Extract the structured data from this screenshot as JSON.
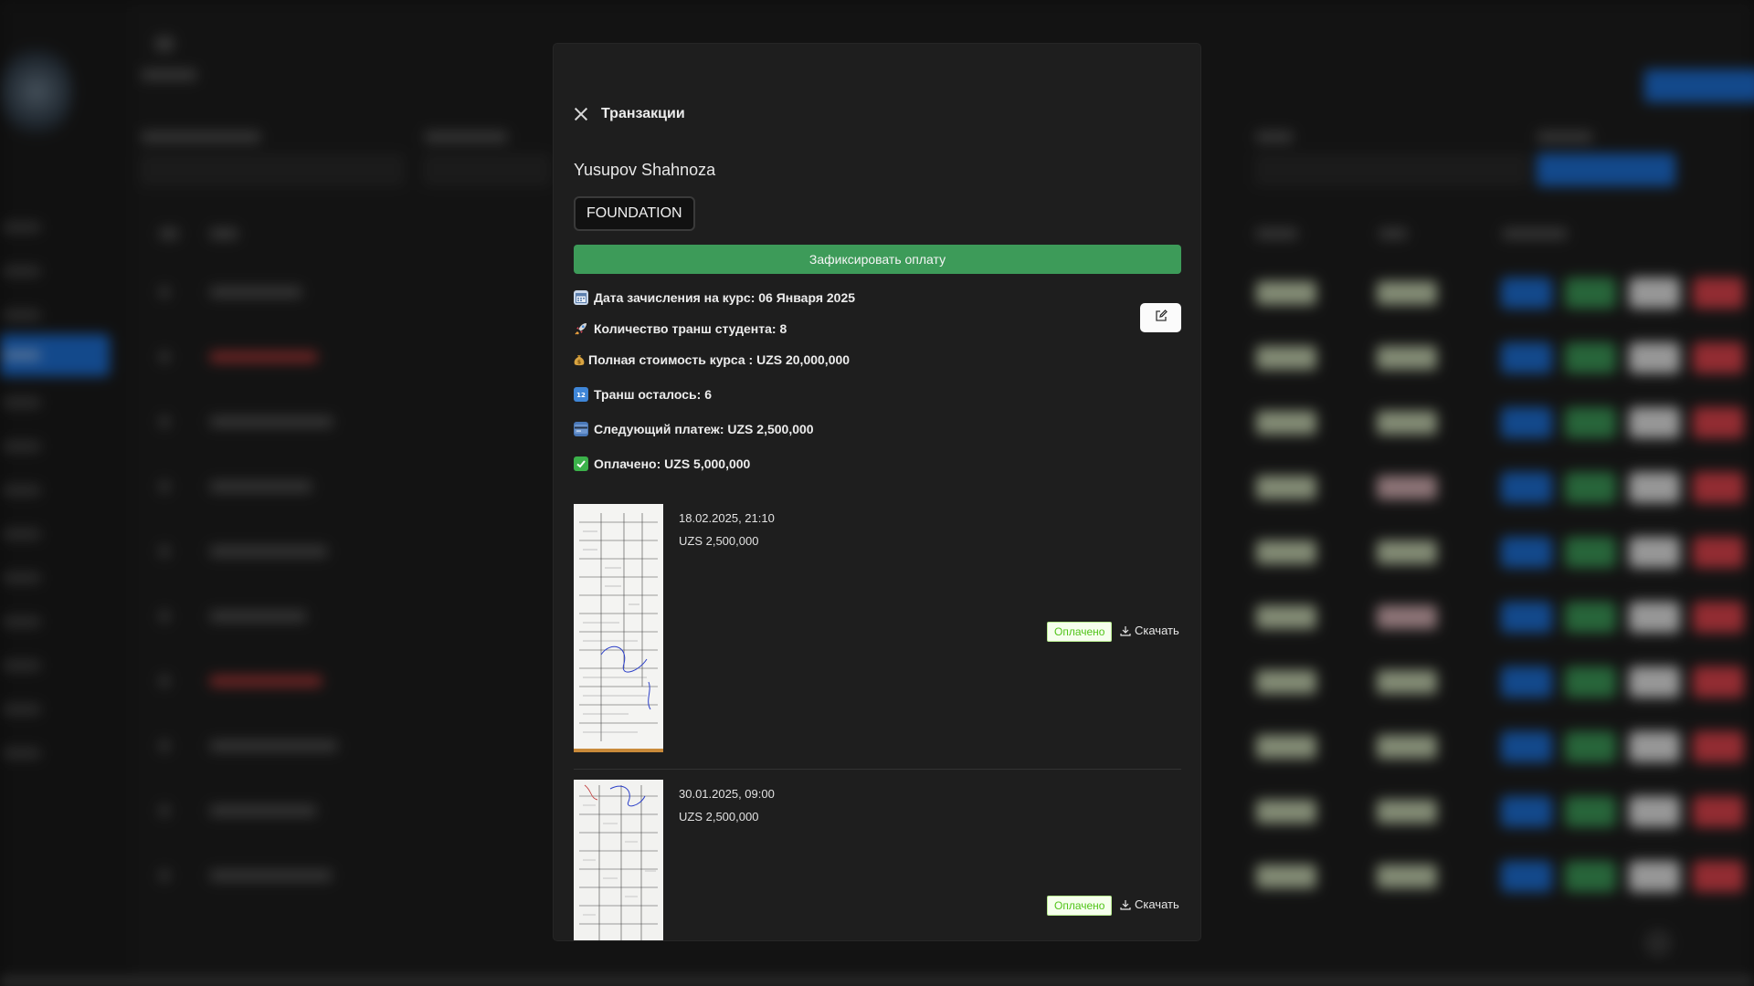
{
  "modal": {
    "title": "Транзакции",
    "student_name": "Yusupov Shahnoza",
    "course_tag": "FOUNDATION",
    "fix_payment_label": "Зафиксировать оплату",
    "info": [
      {
        "icon": "calendar-icon",
        "text": "Дата зачисления на курс: 06 Января 2025"
      },
      {
        "icon": "rocket-icon",
        "text": "Количество транш студента: 8"
      },
      {
        "icon": "money-bag-icon",
        "text": "Полная стоимость курса : UZS 20,000,000"
      },
      {
        "icon": "numbers-icon",
        "text": "Транш осталось: 6"
      },
      {
        "icon": "credit-card-icon",
        "text": "Следующий платеж: UZS 2,500,000"
      },
      {
        "icon": "check-icon",
        "text": "Оплачено: UZS 5,000,000"
      }
    ],
    "transactions": [
      {
        "date": "18.02.2025, 21:10",
        "amount": "UZS 2,500,000",
        "status": "Оплачено",
        "download_label": "Скачать"
      },
      {
        "date": "30.01.2025, 09:00",
        "amount": "UZS 2,500,000",
        "status": "Оплачено",
        "download_label": "Скачать"
      }
    ]
  },
  "colors": {
    "accent_green": "#3d9b59",
    "status_green": "#52c41a",
    "background": "#1e1e1e",
    "primary_blue": "#1e70d6",
    "danger_red": "#e0444d"
  }
}
